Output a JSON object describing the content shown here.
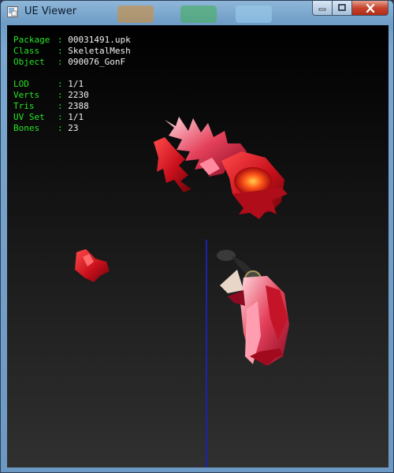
{
  "window": {
    "title": "UE Viewer"
  },
  "info": {
    "package": {
      "key": "Package",
      "value": "00031491.upk"
    },
    "class": {
      "key": "Class",
      "value": "SkeletalMesh"
    },
    "object": {
      "key": "Object",
      "value": "090076_GonF"
    },
    "lod": {
      "key": "LOD",
      "value": "1/1"
    },
    "verts": {
      "key": "Verts",
      "value": "2230"
    },
    "tris": {
      "key": "Tris",
      "value": "2388"
    },
    "uvset": {
      "key": "UV Set",
      "value": "1/1"
    },
    "bones": {
      "key": "Bones",
      "value": "23"
    }
  },
  "colors": {
    "label": "#27e327",
    "value": "#f2f2f2",
    "axis": "#1a22b0",
    "mesh": "#c81e24"
  }
}
